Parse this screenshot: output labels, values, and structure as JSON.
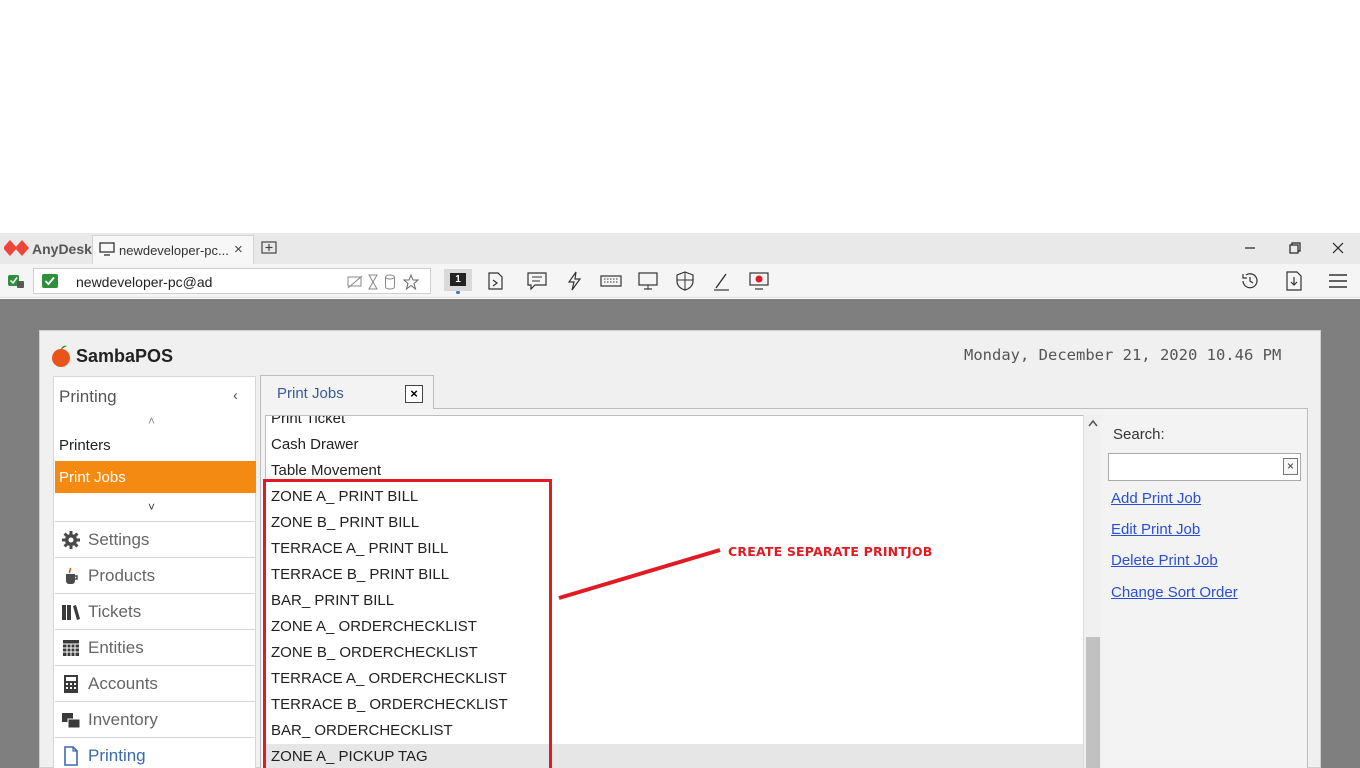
{
  "anydesk": {
    "brand": "AnyDesk",
    "tab_label": "newdeveloper-pc...",
    "tab_close": "×",
    "address": "newdeveloper-pc@ad",
    "session_number": "1"
  },
  "sambapos": {
    "brand": "SambaPOS",
    "datetime": "Monday, December 21, 2020 10.46 PM"
  },
  "sidebar": {
    "title": "Printing",
    "collapse": "‹",
    "scroll_up": "˄",
    "scroll_down": "˅",
    "sub_items": [
      "Printers",
      "Print Jobs"
    ],
    "menu": [
      {
        "label": "Settings",
        "icon": "gear-icon"
      },
      {
        "label": "Products",
        "icon": "cup-icon"
      },
      {
        "label": "Tickets",
        "icon": "books-icon"
      },
      {
        "label": "Entities",
        "icon": "grid-icon"
      },
      {
        "label": "Accounts",
        "icon": "calculator-icon"
      },
      {
        "label": "Inventory",
        "icon": "inventory-icon"
      },
      {
        "label": "Printing",
        "icon": "document-icon"
      }
    ]
  },
  "tab": {
    "label": "Print Jobs",
    "close": "×"
  },
  "print_jobs": [
    "Print Ticket",
    "Cash Drawer",
    "Table Movement",
    "ZONE A_ PRINT BILL",
    "ZONE B_ PRINT BILL",
    "TERRACE A_ PRINT BILL",
    "TERRACE B_ PRINT BILL",
    "BAR_ PRINT BILL",
    "ZONE A_ ORDERCHECKLIST",
    "ZONE B_ ORDERCHECKLIST",
    "TERRACE A_ ORDERCHECKLIST",
    "TERRACE B_ ORDERCHECKLIST",
    "BAR_ ORDERCHECKLIST",
    "ZONE A_ PICKUP TAG"
  ],
  "actions": {
    "search_label": "Search:",
    "search_value": "",
    "clear": "×",
    "add": "Add Print Job",
    "edit": "Edit Print Job",
    "delete": "Delete Print Job",
    "sort": "Change Sort Order"
  },
  "annotation": {
    "text": "CREATE SEPARATE PRINTJOB",
    "color": "#e01b24"
  },
  "colors": {
    "accent": "#f58a12",
    "link": "#2a4fd6"
  }
}
